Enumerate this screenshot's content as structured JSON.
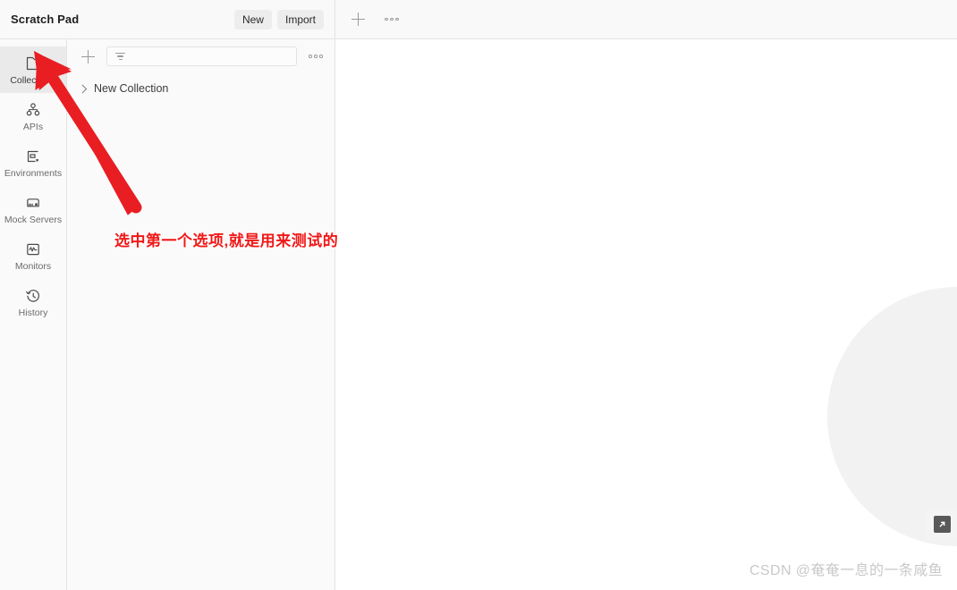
{
  "topbar": {
    "workspace_title": "Scratch Pad",
    "new_label": "New",
    "import_label": "Import",
    "add_tab_icon": "plus-icon",
    "more_icon": "ellipsis-icon"
  },
  "rail": {
    "items": [
      {
        "label": "Collections",
        "icon": "collections-icon",
        "active": true
      },
      {
        "label": "APIs",
        "icon": "apis-icon",
        "active": false
      },
      {
        "label": "Environments",
        "icon": "environments-icon",
        "active": false
      },
      {
        "label": "Mock Servers",
        "icon": "mock-servers-icon",
        "active": false
      },
      {
        "label": "Monitors",
        "icon": "monitors-icon",
        "active": false
      },
      {
        "label": "History",
        "icon": "history-icon",
        "active": false
      }
    ]
  },
  "panel": {
    "create_icon": "plus-icon",
    "filter_icon": "filter-icon",
    "filter_value": "",
    "filter_placeholder": "",
    "more_icon": "ellipsis-icon",
    "tree": [
      {
        "label": "New Collection",
        "expanded": false
      }
    ]
  },
  "main": {
    "expand_icon": "expand-arrow-icon",
    "watermark": "CSDN @奄奄一息的一条咸鱼"
  },
  "annotation": {
    "text": "选中第一个选项,就是用来测试的",
    "arrow_color": "#e81e23",
    "text_color": "#f01818"
  }
}
